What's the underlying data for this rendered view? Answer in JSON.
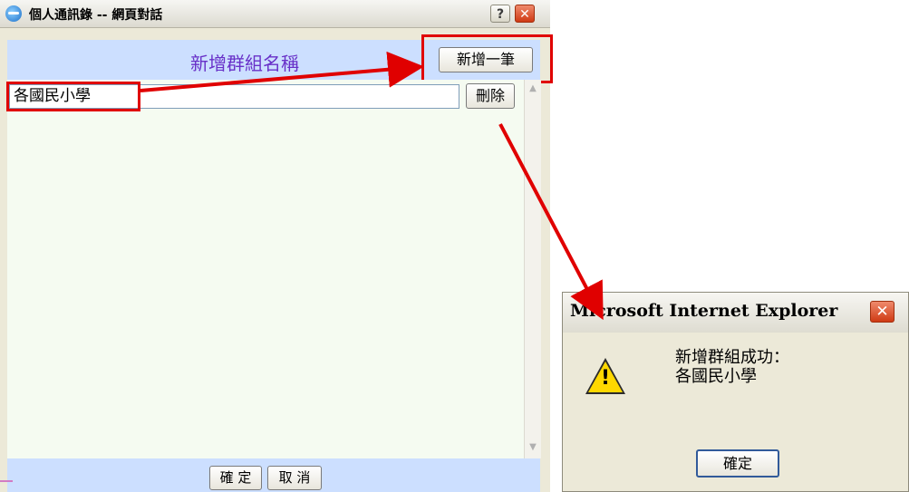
{
  "dialog": {
    "title": "個人通訊錄 -- 網頁對話",
    "help_label": "?",
    "close_label": "✕",
    "header_title": "新增群組名稱",
    "add_button": "新增一筆",
    "group_input_value": "各國民小學",
    "delete_button": "刪除",
    "ok_button": "確 定",
    "cancel_button": "取 消"
  },
  "alert": {
    "title": "Microsoft Internet Explorer",
    "close_label": "✕",
    "message_line1": "新增群組成功：",
    "message_line2": "各國民小學",
    "confirm_button": "確定",
    "icon": "warning-icon"
  },
  "colors": {
    "header_bg": "#ccdfff",
    "content_bg": "#f5fbf1",
    "header_title_color": "#6830c8",
    "highlight_red": "#e00000"
  }
}
